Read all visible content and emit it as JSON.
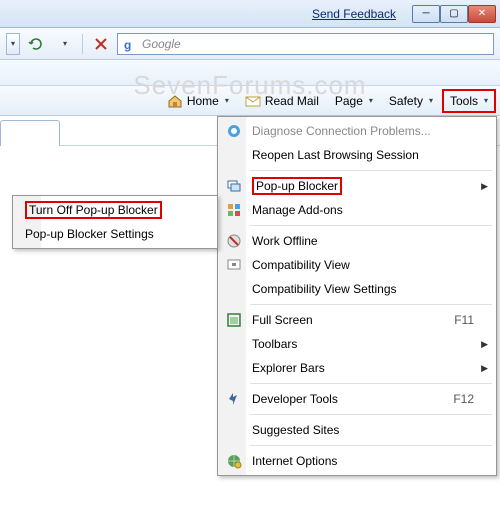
{
  "titlebar": {
    "feedback": "Send Feedback"
  },
  "search": {
    "placeholder": "Google"
  },
  "cmdbar": {
    "home": "Home",
    "readmail": "Read Mail",
    "page": "Page",
    "safety": "Safety",
    "tools": "Tools"
  },
  "toolsMenu": {
    "diagnose": "Diagnose Connection Problems...",
    "reopen": "Reopen Last Browsing Session",
    "popup": "Pop-up Blocker",
    "addons": "Manage Add-ons",
    "offline": "Work Offline",
    "compat": "Compatibility View",
    "compatSettings": "Compatibility View Settings",
    "fullscreen": "Full Screen",
    "fullscreenKey": "F11",
    "toolbars": "Toolbars",
    "explorerBars": "Explorer Bars",
    "devtools": "Developer Tools",
    "devtoolsKey": "F12",
    "suggested": "Suggested Sites",
    "inetopts": "Internet Options"
  },
  "popupSubmenu": {
    "turnoff": "Turn Off Pop-up Blocker",
    "settings": "Pop-up Blocker Settings"
  },
  "watermark": "SevenForums.com"
}
